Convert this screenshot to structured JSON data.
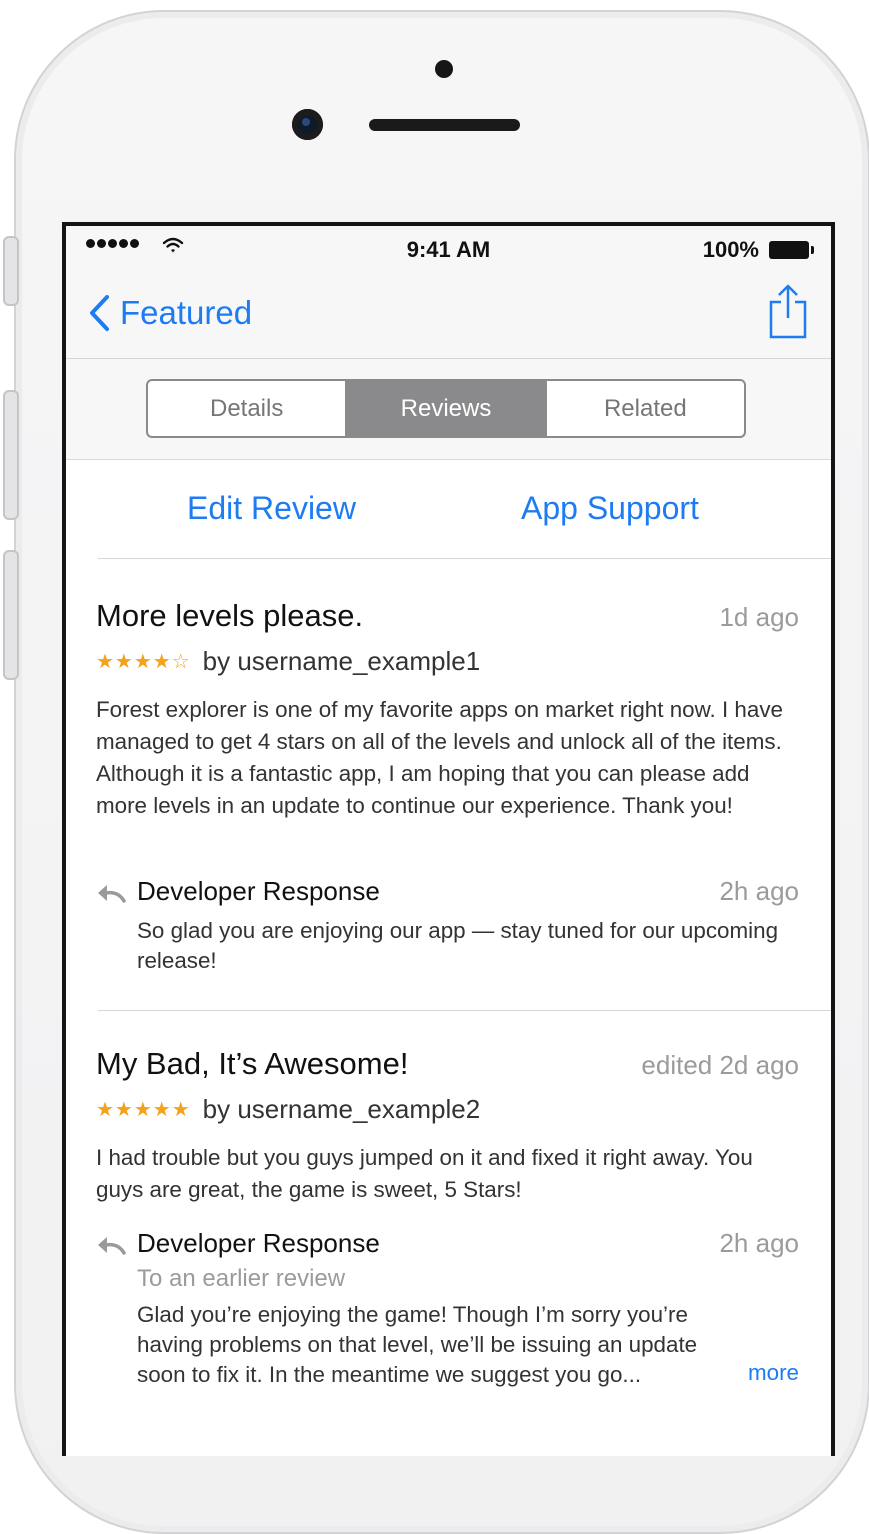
{
  "status_bar": {
    "time": "9:41 AM",
    "battery": "100%",
    "signal_icon": "signal-dots-icon",
    "wifi_icon": "wifi-icon",
    "battery_icon": "battery-icon"
  },
  "nav": {
    "back_label": "Featured",
    "back_icon": "chevron-left-icon",
    "share_icon": "share-icon"
  },
  "tabs": [
    {
      "label": "Details",
      "active": false
    },
    {
      "label": "Reviews",
      "active": true
    },
    {
      "label": "Related",
      "active": false
    }
  ],
  "actions": {
    "edit_review": "Edit Review",
    "app_support": "App Support"
  },
  "reviews": [
    {
      "title": "More levels please.",
      "date": "1d ago",
      "stars": "★★★★☆",
      "rating": 4,
      "byline": "by username_example1",
      "body": "Forest explorer is one of my favorite apps on market right now. I have managed to get 4 stars on all of the levels and unlock all of the items. Although it is a fantastic app, I am hoping that you can please add more levels in an update to continue our experience. Thank you!",
      "response": {
        "title": "Developer Response",
        "date": "2h ago",
        "body": "So glad you are enjoying our app — stay tuned for our upcoming release!"
      }
    },
    {
      "title": "My Bad, It’s Awesome!",
      "date": "edited 2d ago",
      "stars": "★★★★★",
      "rating": 5,
      "byline": "by username_example2",
      "body": "I had trouble but you guys jumped on it and fixed it right away. You guys are great, the game is sweet, 5 Stars!",
      "response": {
        "title": "Developer Response",
        "subtitle": "To an earlier review",
        "date": "2h ago",
        "body": "Glad you’re enjoying the game! Though I’m sorry you’re having problems on that level, we’ll be issuing an update soon to fix it. In the meantime we suggest you go...",
        "more": "more"
      }
    }
  ],
  "colors": {
    "accent": "#1e7cf2",
    "star": "#f4a21c",
    "segment_active": "#8a8a8c",
    "muted_text": "#9b9b9b"
  }
}
